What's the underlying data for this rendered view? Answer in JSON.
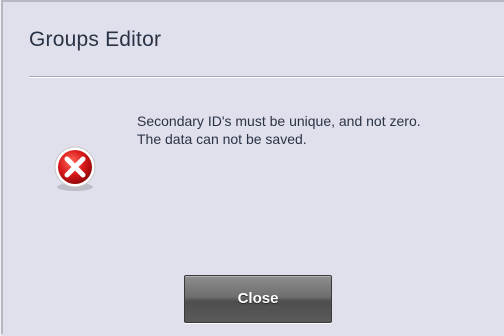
{
  "dialog": {
    "title": "Groups Editor",
    "icon": "error-icon",
    "message_lines": [
      "Secondary ID's must be unique, and not zero.",
      "The data can not be saved."
    ],
    "close_label": "Close"
  },
  "colors": {
    "background": "#e0e0ec",
    "title_text": "#2a3346",
    "error_red": "#d81818",
    "button": "#6e6e6e"
  }
}
